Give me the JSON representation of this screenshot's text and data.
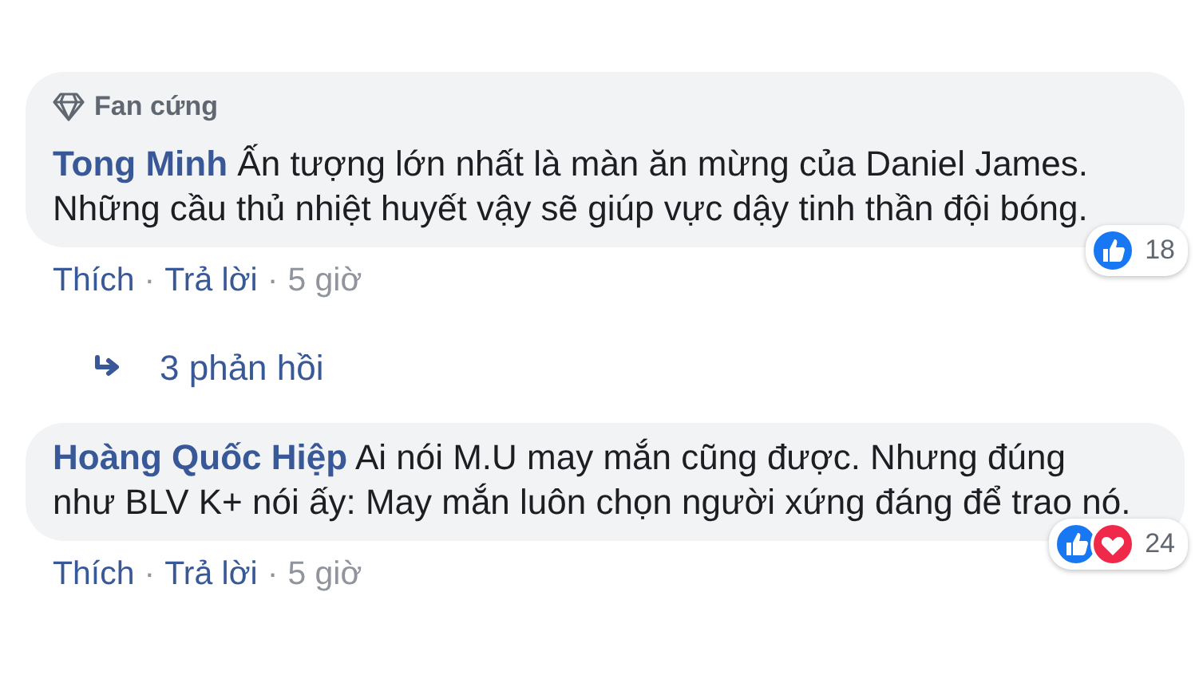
{
  "separator": "·",
  "items": [
    {
      "kind": "comment",
      "badge": "Fan cứng",
      "author": "Tong Minh",
      "text": "Ấn tượng lớn nhất là màn ăn mừng của Daniel James. Những cầu thủ nhiệt huyết vậy sẽ giúp vực dậy tinh thần đội bóng.",
      "actions": [
        "Thích",
        "Trả lời"
      ],
      "time": "5 giờ",
      "reactions": [
        {
          "kind": "like"
        }
      ],
      "reaction_count": "18"
    },
    {
      "kind": "replies",
      "label": "3 phản hồi"
    },
    {
      "kind": "comment",
      "author": "Hoàng Quốc Hiệp",
      "text": "Ai nói M.U may mắn cũng được. Nhưng đúng như BLV K+ nói ấy: May mắn luôn chọn người xứng đáng để trao nó.",
      "actions": [
        "Thích",
        "Trả lời"
      ],
      "time": "5 giờ",
      "reactions": [
        {
          "kind": "like"
        },
        {
          "kind": "love"
        }
      ],
      "reaction_count": "24"
    }
  ]
}
